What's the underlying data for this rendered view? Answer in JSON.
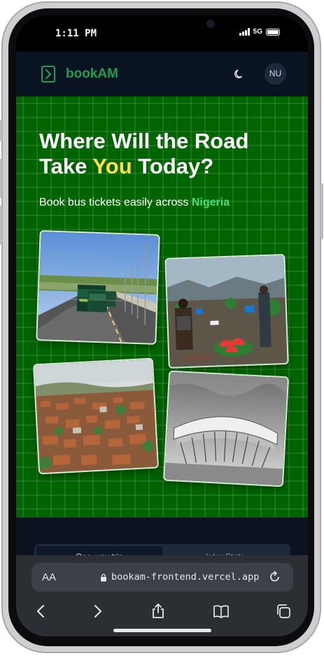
{
  "status_bar": {
    "time": "1:11 PM",
    "network": "5G"
  },
  "header": {
    "brand": "bookAM",
    "avatar_initials": "NU",
    "accent_color": "#1f9d55"
  },
  "hero": {
    "title_line1": "Where Will the Road",
    "title_pre": "Take ",
    "title_highlight": "You",
    "title_post": " Today?",
    "subtitle_pre": "Book bus tickets easily across ",
    "subtitle_highlight": "Nigeria",
    "background_color": "#006400",
    "highlight_color": "#fde047",
    "photos": [
      "bus-highway-photo",
      "market-photo",
      "city-rooftops-photo",
      "stadium-photo"
    ]
  },
  "tabs": {
    "first": "One-way trip",
    "second": "Inter-State"
  },
  "browser": {
    "aa_label": "AA",
    "url": "bookam-frontend.vercel.app"
  }
}
